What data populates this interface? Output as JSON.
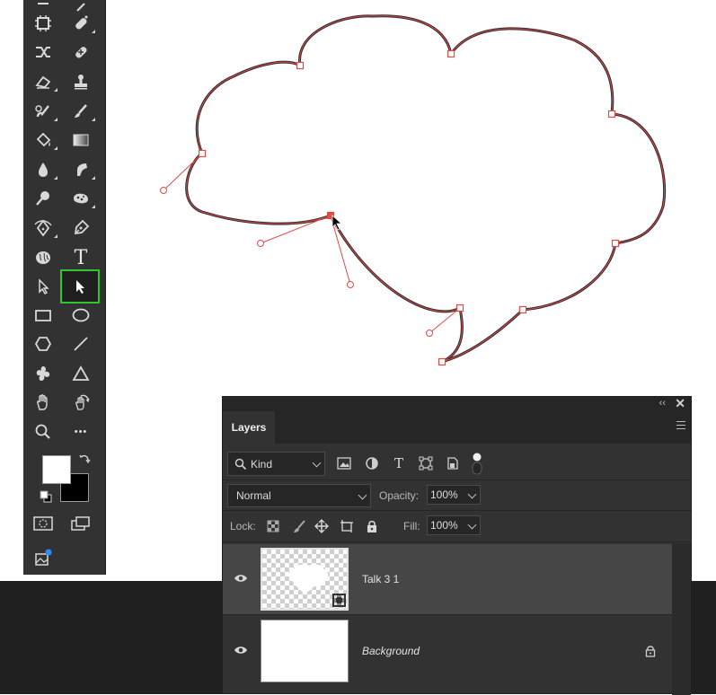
{
  "toolbar": {
    "tools": [
      {
        "name": "frame-tool-icon"
      },
      {
        "name": "healing-brush-icon"
      },
      {
        "name": "content-aware-move-icon"
      },
      {
        "name": "patch-tool-icon"
      },
      {
        "name": "eraser-icon"
      },
      {
        "name": "stamp-icon"
      },
      {
        "name": "history-brush-icon"
      },
      {
        "name": "brush-icon"
      },
      {
        "name": "paint-bucket-icon"
      },
      {
        "name": "gradient-icon"
      },
      {
        "name": "blur-drop-icon"
      },
      {
        "name": "smudge-icon"
      },
      {
        "name": "dodge-icon"
      },
      {
        "name": "sponge-icon"
      },
      {
        "name": "curvature-pen-icon"
      },
      {
        "name": "pen-icon"
      },
      {
        "name": "brain-icon"
      },
      {
        "name": "type-icon"
      },
      {
        "name": "path-selection-icon"
      },
      {
        "name": "direct-selection-icon",
        "active": true
      },
      {
        "name": "rectangle-icon"
      },
      {
        "name": "ellipse-icon"
      },
      {
        "name": "polygon-icon"
      },
      {
        "name": "line-icon"
      },
      {
        "name": "custom-shape-icon"
      },
      {
        "name": "triangle-icon"
      },
      {
        "name": "hand-icon"
      },
      {
        "name": "rotate-view-icon"
      },
      {
        "name": "zoom-icon"
      },
      {
        "name": "more-icon"
      }
    ],
    "type_glyph": "T",
    "more_glyph": "•••",
    "foreground_color": "#ffffff",
    "background_color": "#000000"
  },
  "canvas": {
    "path_color": "#e24a4a"
  },
  "layers_panel": {
    "tab_label": "Layers",
    "collapse_glyph": "‹‹",
    "close_glyph": "✕",
    "filter_kind": "Kind",
    "blend_mode": "Normal",
    "opacity_label": "Opacity:",
    "opacity_value": "100%",
    "lock_label": "Lock:",
    "fill_label": "Fill:",
    "fill_value": "100%",
    "layers": [
      {
        "name": "Talk 3 1",
        "selected": true,
        "visible": true
      },
      {
        "name": "Background",
        "selected": false,
        "visible": true,
        "locked": true
      }
    ]
  }
}
